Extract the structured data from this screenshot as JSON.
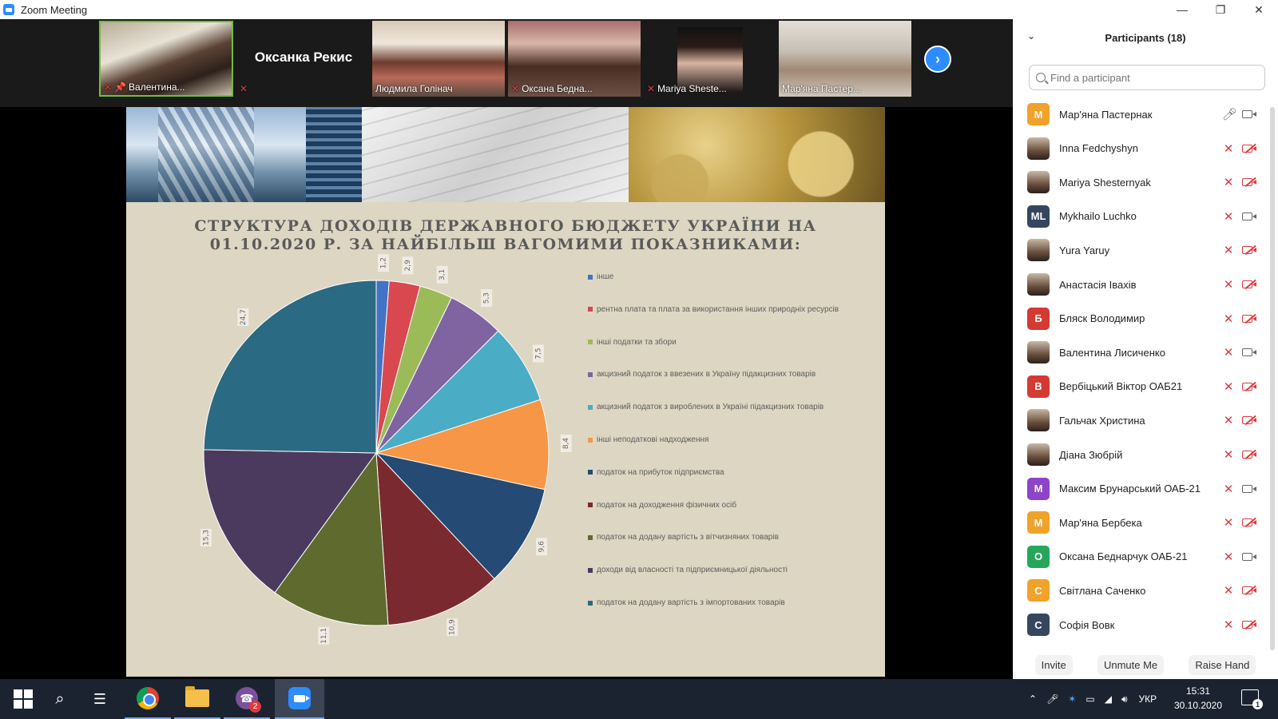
{
  "window": {
    "title": "Zoom Meeting"
  },
  "strip": {
    "tiles": [
      {
        "name": "Валентина...",
        "mic_off": true
      },
      {
        "name": "Оксанка Рекис",
        "mic_off": true
      },
      {
        "name": "Людмила Голінач",
        "mic_off": false
      },
      {
        "name": "Оксана Бедна...",
        "mic_off": true
      },
      {
        "name": "Mariya Sheste...",
        "mic_off": true
      },
      {
        "name": "Мар'яна Пастер...",
        "mic_off": false
      }
    ]
  },
  "slide": {
    "title_line1": "СТРУКТУРА ДОХОДІВ ДЕРЖАВНОГО БЮДЖЕТУ УКРАЇНИ НА",
    "title_line2": "01.10.2020 Р. ЗА НАЙБІЛЬШ ВАГОМИМИ ПОКАЗНИКАМИ:"
  },
  "chart_data": {
    "type": "pie",
    "categories": [
      "інше",
      "рентна плата та плата за використання інших природніх ресурсів",
      "інші податки та збори",
      "акцизний податок з ввезених в Україну підакцизних товарів",
      "акцизний податок з вироблених в Україні підакцизних товарів",
      "інші неподаткові надходження",
      "податок на прибуток підприємства",
      "податок на доходження фізичних осіб",
      "податок на додану вартість з вітчизняних товарів",
      "доходи від власності та підприємницької діяльності",
      "податок на додану вартість з імпортованих товарів"
    ],
    "values": [
      1.2,
      2.9,
      3.1,
      5.3,
      7.5,
      8.4,
      9.6,
      10.9,
      11.1,
      15.3,
      24.7
    ],
    "labels": [
      "1,2",
      "2,9",
      "3,1",
      "5,3",
      "7,5",
      "8,4",
      "9,6",
      "10,9",
      "11,1",
      "15,3",
      "24,7"
    ],
    "colors": [
      "#4472c4",
      "#d9484f",
      "#9bbb59",
      "#8064a2",
      "#4bacc6",
      "#f79646",
      "#254a74",
      "#7a2a2e",
      "#5f6b2e",
      "#4b3a5e",
      "#2a6a82"
    ],
    "legend_position": "right"
  },
  "panel": {
    "title": "Participants (18)",
    "search_placeholder": "Find a participant",
    "participants": [
      {
        "name": "Мар'яна Пастернак",
        "initial": "М",
        "color": "#f0a22a",
        "mic": "on",
        "cam": "on"
      },
      {
        "name": "Inna Fedchyshyn",
        "initial": "",
        "color": "",
        "mic": "off",
        "cam": "off"
      },
      {
        "name": "Mariya Shesternyak",
        "initial": "",
        "color": "",
        "mic": "off",
        "cam": "off"
      },
      {
        "name": "Mykhailo Luchko",
        "initial": "ML",
        "color": "#36465f",
        "mic": "off",
        "cam": "on"
      },
      {
        "name": "Yura Yaruy",
        "initial": "",
        "color": "",
        "mic": "off",
        "cam": "off"
      },
      {
        "name": "Анастасія Іваxів",
        "initial": "",
        "color": "",
        "mic": "off",
        "cam": "off"
      },
      {
        "name": "Бляск Володимир",
        "initial": "Б",
        "color": "#d33b32",
        "mic": "off",
        "cam": "off"
      },
      {
        "name": "Валентина Лисиченко",
        "initial": "",
        "color": "",
        "mic": "off",
        "cam": "on"
      },
      {
        "name": "Вербіцький Віктор ОАБ21",
        "initial": "В",
        "color": "#d33b32",
        "mic": "off",
        "cam": "off"
      },
      {
        "name": "Гальчак Христина",
        "initial": "",
        "color": "",
        "mic": "off",
        "cam": "off"
      },
      {
        "name": "Діана Зюбрій",
        "initial": "",
        "color": "",
        "mic": "off",
        "cam": "off"
      },
      {
        "name": "Максим Брунарський ОАБ-21",
        "initial": "М",
        "color": "#8e44c9",
        "mic": "off",
        "cam": "on"
      },
      {
        "name": "Мар'яна Бербека",
        "initial": "М",
        "color": "#f0a22a",
        "mic": "off",
        "cam": "off"
      },
      {
        "name": "Оксана Беднарчук ОАБ-21",
        "initial": "О",
        "color": "#26a65b",
        "mic": "off",
        "cam": "on"
      },
      {
        "name": "Світлана Саченко",
        "initial": "С",
        "color": "#f0a22a",
        "mic": "off",
        "cam": "off"
      },
      {
        "name": "Софія Вовк",
        "initial": "С",
        "color": "#36465f",
        "mic": "off",
        "cam": "off"
      }
    ],
    "buttons": {
      "invite": "Invite",
      "unmute": "Unmute Me",
      "raise": "Raise Hand"
    }
  },
  "taskbar": {
    "viber_badge": "2",
    "language": "УКР",
    "time": "15:31",
    "date": "30.10.2020",
    "notifications": "1"
  }
}
